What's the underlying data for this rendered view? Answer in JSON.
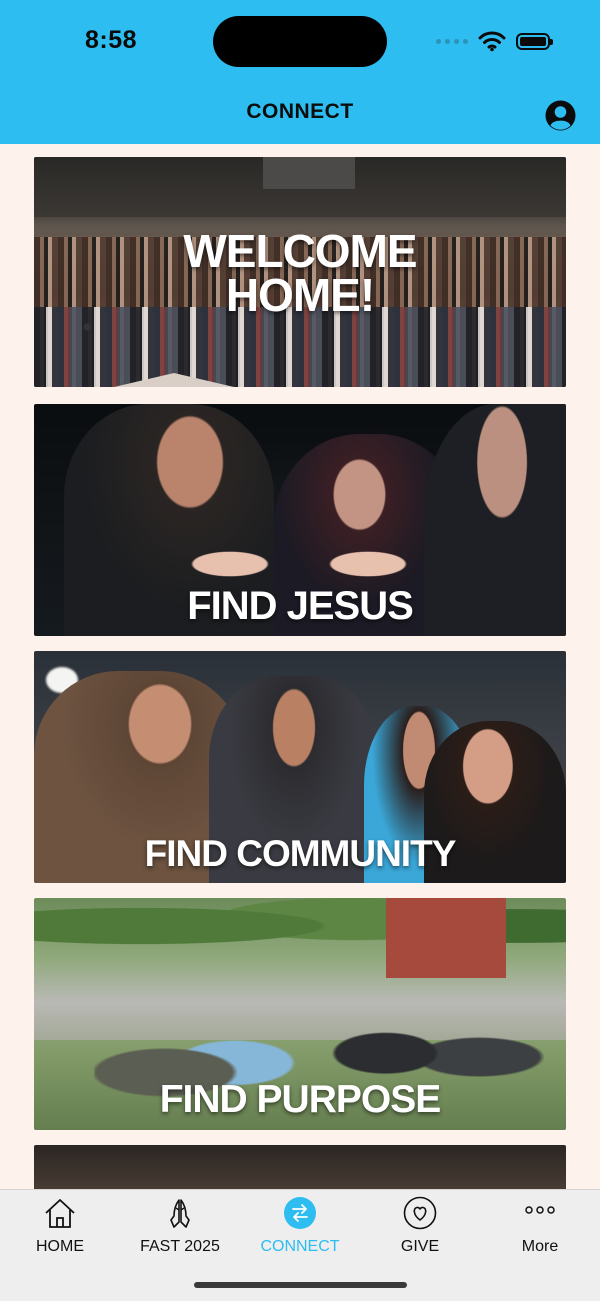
{
  "status_bar": {
    "time": "8:58"
  },
  "header": {
    "title": "CONNECT"
  },
  "cards": [
    {
      "title_line1": "WELCOME",
      "title_line2": "HOME!"
    },
    {
      "title": "FIND JESUS"
    },
    {
      "title": "FIND COMMUNITY"
    },
    {
      "title": "FIND PURPOSE"
    }
  ],
  "tabbar": {
    "items": [
      {
        "label": "HOME",
        "icon": "house-icon"
      },
      {
        "label": "FAST 2025",
        "icon": "praying-hands-icon"
      },
      {
        "label": "CONNECT",
        "icon": "swap-arrows-icon",
        "active": true
      },
      {
        "label": "GIVE",
        "icon": "heart-icon"
      },
      {
        "label": "More",
        "icon": "ellipsis-icon"
      }
    ]
  },
  "colors": {
    "accent": "#2dbdf0",
    "background": "#fdf3ec",
    "tabbar": "#eeeeee"
  }
}
